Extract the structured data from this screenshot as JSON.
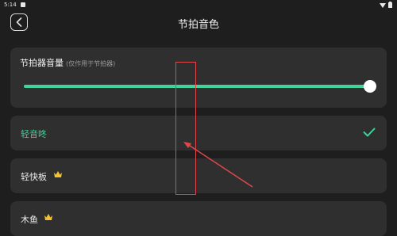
{
  "status_bar": {
    "time": "5:14"
  },
  "header": {
    "title": "节拍音色"
  },
  "volume": {
    "title": "节拍器音量",
    "hint": "(仅作用于节拍器)",
    "level": 1.0
  },
  "options": [
    {
      "label": "轻音咚",
      "selected": true,
      "premium": false
    },
    {
      "label": "轻快板",
      "selected": false,
      "premium": true
    },
    {
      "label": "木鱼",
      "selected": false,
      "premium": true
    }
  ],
  "colors": {
    "accent": "#3fd49a",
    "background": "#1e1e1e",
    "card": "#2f2f2f",
    "crown": "#f2c230",
    "annotation": "#e0474c"
  },
  "icons": [
    "back-icon",
    "check-icon",
    "crown-icon",
    "wifi-icon",
    "battery-icon"
  ]
}
